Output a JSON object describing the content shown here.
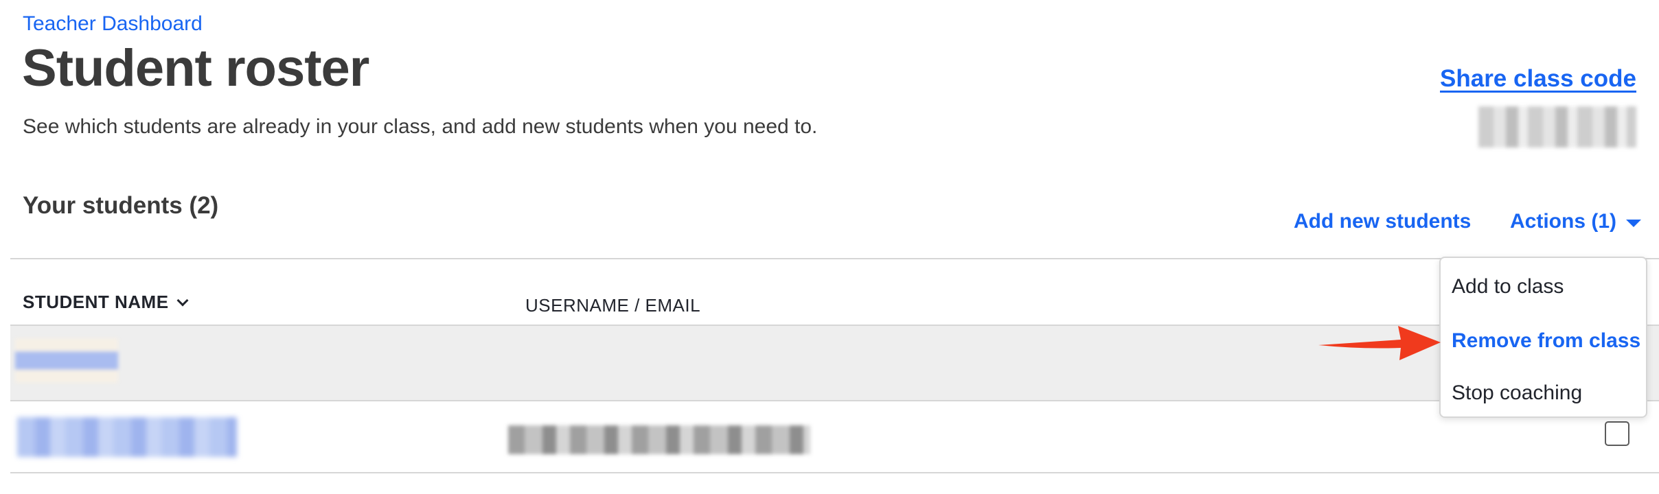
{
  "header": {
    "breadcrumb": "Teacher Dashboard",
    "title": "Student roster",
    "subtitle": "See which students are already in your class, and add new students when you need to.",
    "share_link": "Share class code"
  },
  "students_section": {
    "title": "Your students (2)",
    "add_new_label": "Add new students",
    "actions_label": "Actions (1)"
  },
  "table": {
    "columns": [
      "STUDENT NAME",
      "USERNAME / EMAIL"
    ],
    "row_count": 2
  },
  "actions_menu": {
    "items": [
      "Add to class",
      "Remove from class",
      "Stop coaching"
    ]
  },
  "colors": {
    "accent": "#1865f2",
    "annotation_arrow": "#f03a1d"
  }
}
